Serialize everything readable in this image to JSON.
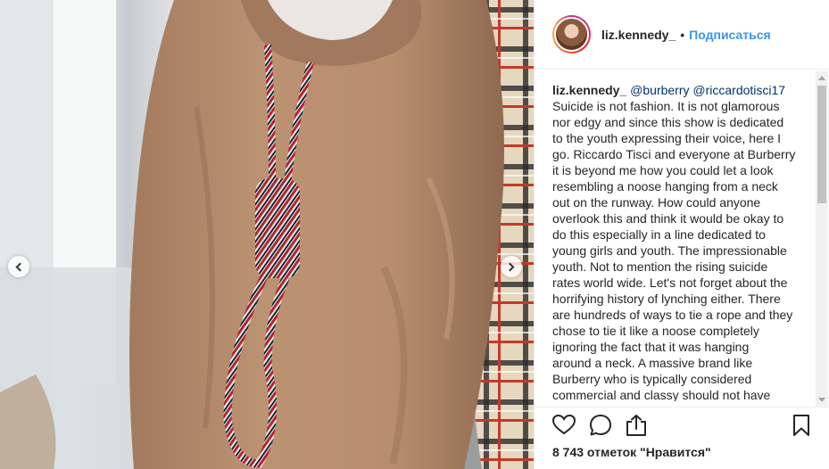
{
  "header": {
    "username": "liz.kennedy_",
    "separator": "•",
    "follow_label": "Подписаться"
  },
  "caption": {
    "username": "liz.kennedy_",
    "mentions": [
      "@burberry",
      "@riccardotisci17"
    ],
    "text": "Suicide is not fashion. It is not glamorous\nnor edgy and since this show is dedicated\nto the youth expressing their voice, here I\ngo. Riccardo Tisci and everyone at Burberry\nit is beyond me how you could let a look\nresembling a noose hanging from a neck\nout on the runway. How could anyone\noverlook this and think it would be okay to\ndo this especially in a line dedicated to\nyoung girls and youth. The impressionable\nyouth. Not to mention the rising suicide\nrates world wide. Let's not forget about the\nhorrifying history of lynching either. There\nare hundreds of ways to tie a rope and they\nchose to tie it like a noose completely\nignoring the fact that it was hanging\naround a neck. A massive brand like\nBurberry who is typically considered\ncommercial and classy should not have"
  },
  "actions": {
    "like_icon": "heart-icon",
    "comment_icon": "comment-icon",
    "share_icon": "share-icon",
    "save_icon": "bookmark-icon"
  },
  "likes": {
    "text": "8 743 отметок \"Нравится\""
  },
  "carousel": {
    "prev_icon": "chevron-left-icon",
    "next_icon": "chevron-right-icon"
  },
  "colors": {
    "link": "#3897f0",
    "mention": "#003569",
    "text": "#262626"
  }
}
